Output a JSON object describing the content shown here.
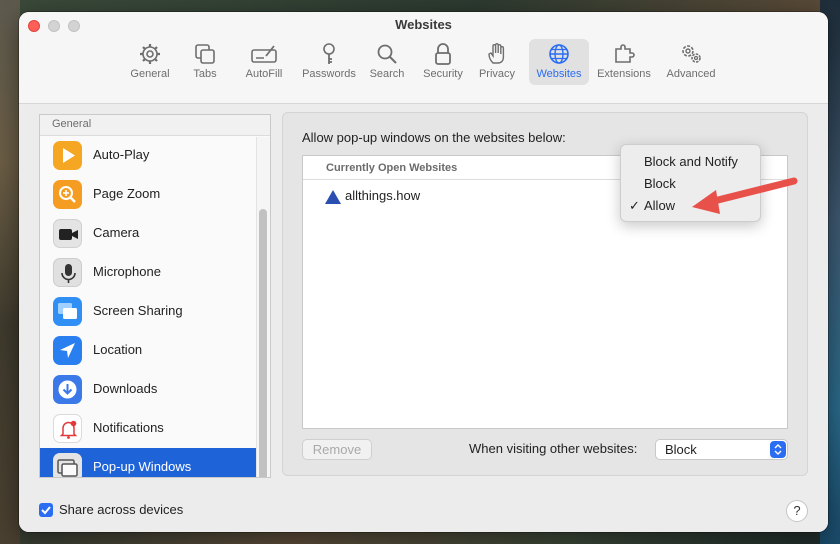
{
  "window": {
    "title": "Websites"
  },
  "toolbar": {
    "items": [
      {
        "label": "General",
        "icon": "gear-icon"
      },
      {
        "label": "Tabs",
        "icon": "tabs-icon"
      },
      {
        "label": "AutoFill",
        "icon": "autofill-icon"
      },
      {
        "label": "Passwords",
        "icon": "key-icon"
      },
      {
        "label": "Search",
        "icon": "search-icon"
      },
      {
        "label": "Security",
        "icon": "lock-icon"
      },
      {
        "label": "Privacy",
        "icon": "hand-icon"
      },
      {
        "label": "Websites",
        "icon": "globe-icon",
        "active": true
      },
      {
        "label": "Extensions",
        "icon": "puzzle-icon"
      },
      {
        "label": "Advanced",
        "icon": "gears-icon"
      }
    ]
  },
  "sidebar": {
    "section": "General",
    "items": [
      {
        "label": "Auto-Play",
        "icon": "play-icon",
        "color": "#f5a623"
      },
      {
        "label": "Page Zoom",
        "icon": "zoom-icon",
        "color": "#f59d23"
      },
      {
        "label": "Camera",
        "icon": "camera-icon",
        "color": "#e4e4e4"
      },
      {
        "label": "Microphone",
        "icon": "microphone-icon",
        "color": "#e0e0e0"
      },
      {
        "label": "Screen Sharing",
        "icon": "screen-sharing-icon",
        "color": "#2f8ff5"
      },
      {
        "label": "Location",
        "icon": "location-icon",
        "color": "#2a7ff0"
      },
      {
        "label": "Downloads",
        "icon": "download-icon",
        "color": "#3b78e8"
      },
      {
        "label": "Notifications",
        "icon": "bell-icon",
        "color": "#ffffff"
      },
      {
        "label": "Pop-up Windows",
        "icon": "popup-windows-icon",
        "color": "#e4e4e4",
        "selected": true
      }
    ]
  },
  "main": {
    "caption": "Allow pop-up windows on the websites below:",
    "table_header": "Currently Open Websites",
    "rows": [
      {
        "site": "allthings.how"
      }
    ],
    "remove_label": "Remove",
    "visiting_label": "When visiting other websites:",
    "visiting_value": "Block"
  },
  "popup_menu": {
    "options": [
      "Block and Notify",
      "Block",
      "Allow"
    ],
    "checked": "Allow",
    "check_mark": "✓"
  },
  "footer": {
    "share_label": "Share across devices",
    "share_checked": true,
    "help_label": "?"
  },
  "colors": {
    "accent": "#2a6df3",
    "selection": "#1f63d9",
    "annotation_arrow": "#e8504a"
  }
}
